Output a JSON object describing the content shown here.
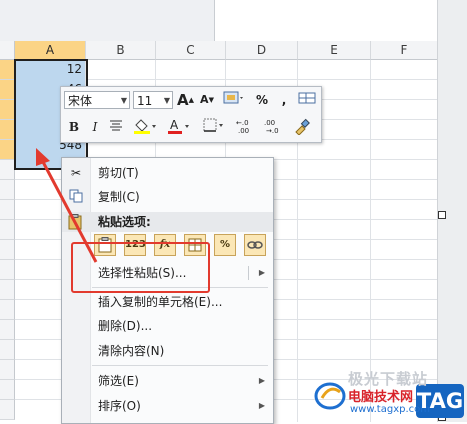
{
  "sheet": {
    "columns": [
      "A",
      "B",
      "C",
      "D",
      "E",
      "F"
    ],
    "selected_column": "A",
    "cell_values": [
      "12",
      "46",
      "",
      "",
      "",
      "",
      "548"
    ]
  },
  "mini_toolbar": {
    "font_name": "宋体",
    "font_size": "11",
    "grow_font": "A",
    "shrink_font": "A",
    "percent": "%",
    "comma": ",",
    "bold": "B",
    "italic": "I",
    "increase_decimal": ".0→.00",
    "decrease_decimal": ".00→.0"
  },
  "context_menu": {
    "cut": "剪切(T)",
    "copy": "复制(C)",
    "paste_options_header": "粘贴选项:",
    "paste_buttons": [
      "",
      "123",
      "fx",
      "",
      "%",
      ""
    ],
    "paste_special": "选择性粘贴(S)...",
    "insert_copied_cells": "插入复制的单元格(E)...",
    "delete": "删除(D)...",
    "clear_contents": "清除内容(N)",
    "filter": "筛选(E)",
    "sort": "排序(O)"
  },
  "watermark": {
    "brand_cn": "极光下载站",
    "site_name": "电脑技术网",
    "url": "www.tagxp.com",
    "tag": "TAG"
  },
  "colors": {
    "selection_fill": "#bdd7ee",
    "header_highlight": "#fbd486",
    "annotation_red": "#e23a2e",
    "tag_blue": "#1565c0"
  }
}
